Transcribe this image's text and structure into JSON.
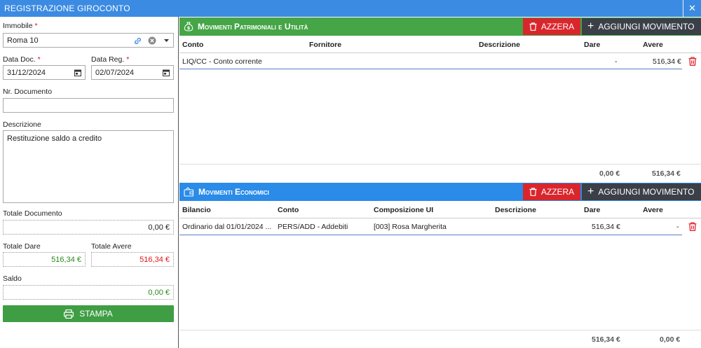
{
  "window": {
    "title": "REGISTRAZIONE GIROCONTO",
    "close_label": "✕"
  },
  "form": {
    "immobile_label": "Immobile",
    "immobile_value": "Roma 10",
    "data_doc_label": "Data Doc.",
    "data_doc_value": "31/12/2024",
    "data_reg_label": "Data Reg.",
    "data_reg_value": "02/07/2024",
    "nr_documento_label": "Nr. Documento",
    "nr_documento_value": "",
    "descrizione_label": "Descrizione",
    "descrizione_value": "Restituzione saldo a credito",
    "totale_documento_label": "Totale Documento",
    "totale_documento_value": "0,00 €",
    "totale_dare_label": "Totale Dare",
    "totale_dare_value": "516,34 €",
    "totale_avere_label": "Totale Avere",
    "totale_avere_value": "516,34 €",
    "saldo_label": "Saldo",
    "saldo_value": "0,00 €",
    "stampa_label": "STAMPA",
    "required_mark": "*"
  },
  "patrimoniali": {
    "title": "Movimenti Patrimoniali e Utilità",
    "azzera_label": "AZZERA",
    "add_label": "AGGIUNGI MOVIMENTO",
    "columns": [
      "Conto",
      "Fornitore",
      "Descrizione",
      "Dare",
      "Avere"
    ],
    "rows": [
      {
        "conto": "LIQ/CC - Conto corrente",
        "fornitore": "",
        "descrizione": "",
        "dare": "-",
        "avere": "516,34 €"
      }
    ],
    "total_dare": "0,00 €",
    "total_avere": "516,34 €"
  },
  "economici": {
    "title": "Movimenti Economici",
    "azzera_label": "AZZERA",
    "add_label": "AGGIUNGI MOVIMENTO",
    "columns": [
      "Bilancio",
      "Conto",
      "Composizione UI",
      "Descrizione",
      "Dare",
      "Avere"
    ],
    "rows": [
      {
        "bilancio": "Ordinario dal 01/01/2024 ...",
        "conto": "PERS/ADD - Addebiti",
        "composizione": "[003] Rosa Margherita",
        "descrizione": "",
        "dare": "516,34 €",
        "avere": "-"
      }
    ],
    "total_dare": "516,34 €",
    "total_avere": "0,00 €"
  },
  "colors": {
    "title_blue": "#3b8be2",
    "green_header": "#45a547",
    "blue_header": "#2a8be8",
    "red": "#d9262d",
    "dark": "#3b3f47"
  }
}
